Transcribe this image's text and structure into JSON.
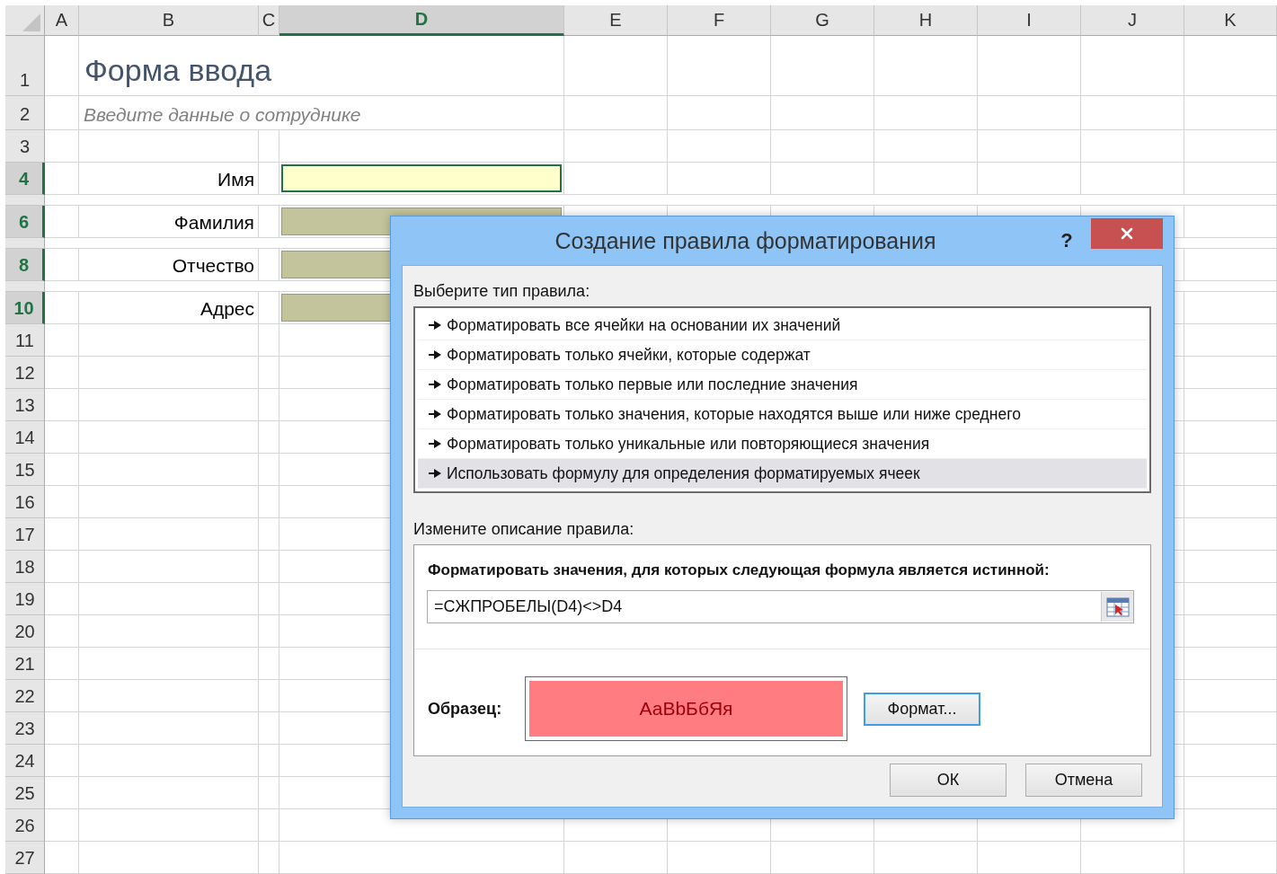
{
  "columns": [
    {
      "label": "A",
      "selected": false
    },
    {
      "label": "B",
      "selected": false
    },
    {
      "label": "C",
      "selected": false
    },
    {
      "label": "D",
      "selected": true
    },
    {
      "label": "E",
      "selected": false
    },
    {
      "label": "F",
      "selected": false
    },
    {
      "label": "G",
      "selected": false
    },
    {
      "label": "H",
      "selected": false
    },
    {
      "label": "I",
      "selected": false
    },
    {
      "label": "J",
      "selected": false
    },
    {
      "label": "K",
      "selected": false
    }
  ],
  "rows": [
    {
      "kind": "title",
      "label": "1",
      "selected": false,
      "text": "Форма ввода"
    },
    {
      "kind": "subtitle",
      "label": "2",
      "selected": false,
      "text": "Введите данные о сотруднике"
    },
    {
      "kind": "plain",
      "label": "3",
      "selected": false
    },
    {
      "kind": "field",
      "label": "4",
      "selected": true,
      "text": "Имя",
      "active": true
    },
    {
      "kind": "collapsed"
    },
    {
      "kind": "field",
      "label": "6",
      "selected": true,
      "text": "Фамилия",
      "active": false
    },
    {
      "kind": "collapsed"
    },
    {
      "kind": "field",
      "label": "8",
      "selected": true,
      "text": "Отчество",
      "active": false
    },
    {
      "kind": "collapsed"
    },
    {
      "kind": "field",
      "label": "10",
      "selected": true,
      "text": "Адрес",
      "active": false
    },
    {
      "kind": "plain",
      "label": "11",
      "selected": false
    },
    {
      "kind": "plain",
      "label": "12",
      "selected": false
    },
    {
      "kind": "plain",
      "label": "13",
      "selected": false
    },
    {
      "kind": "plain",
      "label": "14",
      "selected": false
    },
    {
      "kind": "plain",
      "label": "15",
      "selected": false
    },
    {
      "kind": "plain",
      "label": "16",
      "selected": false
    },
    {
      "kind": "plain",
      "label": "17",
      "selected": false
    },
    {
      "kind": "plain",
      "label": "18",
      "selected": false
    },
    {
      "kind": "plain",
      "label": "19",
      "selected": false
    },
    {
      "kind": "plain",
      "label": "20",
      "selected": false
    },
    {
      "kind": "plain",
      "label": "21",
      "selected": false
    },
    {
      "kind": "plain",
      "label": "22",
      "selected": false
    },
    {
      "kind": "plain",
      "label": "23",
      "selected": false
    },
    {
      "kind": "plain",
      "label": "24",
      "selected": false
    },
    {
      "kind": "plain",
      "label": "25",
      "selected": false
    },
    {
      "kind": "plain",
      "label": "26",
      "selected": false
    },
    {
      "kind": "plain",
      "label": "27",
      "selected": false
    }
  ],
  "dialog": {
    "title": "Создание правила форматирования",
    "help": "?",
    "rule_type_label": "Выберите тип правила:",
    "rule_types": [
      {
        "label": "Форматировать все ячейки на основании их значений",
        "selected": false
      },
      {
        "label": "Форматировать только ячейки, которые содержат",
        "selected": false
      },
      {
        "label": "Форматировать только первые или последние значения",
        "selected": false
      },
      {
        "label": "Форматировать только значения, которые находятся выше или ниже среднего",
        "selected": false
      },
      {
        "label": "Форматировать только уникальные или повторяющиеся значения",
        "selected": false
      },
      {
        "label": "Использовать формулу для определения форматируемых ячеек",
        "selected": true
      }
    ],
    "description_label": "Измените описание правила:",
    "formula_label": "Форматировать значения, для которых следующая формула является истинной:",
    "formula": "=СЖПРОБЕЛЫ(D4)<>D4",
    "sample_label": "Образец:",
    "sample_text": "АаBbБбЯя",
    "format_button": "Формат...",
    "buttons": [
      "ОК",
      "Отмена"
    ]
  }
}
